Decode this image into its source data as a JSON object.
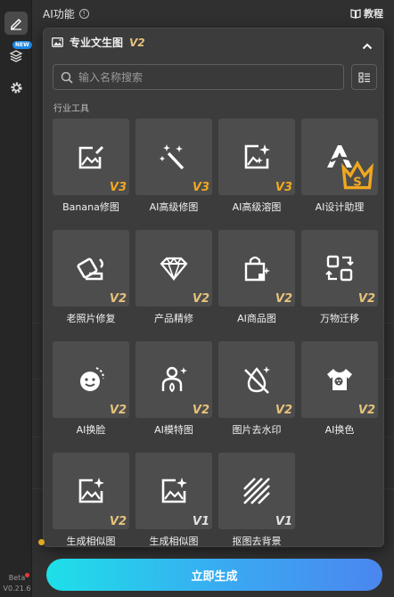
{
  "sidebar": {
    "new_badge": "NEW",
    "beta_label": "Beta",
    "version": "V0.21.6"
  },
  "header": {
    "title": "AI功能",
    "info_glyph": "!",
    "tutorial_label": "教程"
  },
  "popup": {
    "title": "专业文生图",
    "version_tag": "V2",
    "search_placeholder": "输入名称搜索",
    "section_label": "行业工具",
    "tools": [
      {
        "label": "Banana修图",
        "version": "V3",
        "icon": "image-pencil-icon"
      },
      {
        "label": "AI高级修图",
        "version": "V3",
        "icon": "magic-wand-icon"
      },
      {
        "label": "AI高级溶图",
        "version": "V3",
        "icon": "image-sparkle-icon"
      },
      {
        "label": "AI设计助理",
        "version": "",
        "icon": "ai-logo-icon"
      },
      {
        "label": "老照片修复",
        "version": "V2",
        "icon": "restore-photo-icon"
      },
      {
        "label": "产品精修",
        "version": "V2",
        "icon": "gem-icon"
      },
      {
        "label": "AI商品图",
        "version": "V2",
        "icon": "shopping-bag-icon"
      },
      {
        "label": "万物迁移",
        "version": "V2",
        "icon": "transfer-icon"
      },
      {
        "label": "AI换脸",
        "version": "V2",
        "icon": "face-swap-icon"
      },
      {
        "label": "AI模特图",
        "version": "V2",
        "icon": "model-icon"
      },
      {
        "label": "图片去水印",
        "version": "V2",
        "icon": "remove-watermark-icon"
      },
      {
        "label": "AI换色",
        "version": "V2",
        "icon": "color-palette-icon"
      },
      {
        "label": "生成相似图",
        "version": "V2",
        "icon": "similar-image-icon"
      },
      {
        "label": "生成相似图",
        "version": "V1",
        "icon": "similar-image-icon"
      },
      {
        "label": "抠图去背景",
        "version": "V1",
        "icon": "remove-background-icon"
      }
    ]
  },
  "actions": {
    "generate_label": "立即生成"
  }
}
